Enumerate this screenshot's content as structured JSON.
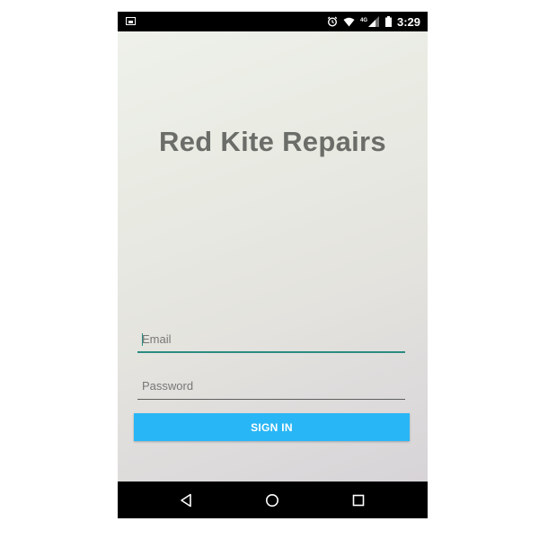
{
  "status_bar": {
    "time": "3:29",
    "icons": [
      "image-notification-icon",
      "alarm-icon",
      "wifi-icon",
      "signal-icon",
      "battery-icon"
    ]
  },
  "app": {
    "title": "Red Kite Repairs",
    "accent_color": "#29b6f6",
    "focus_color": "#2b8c82"
  },
  "login_form": {
    "email_placeholder": "Email",
    "email_value": "",
    "password_placeholder": "Password",
    "password_value": "",
    "sign_in_label": "SIGN IN"
  },
  "nav_bar": {
    "buttons": [
      "back-icon",
      "home-icon",
      "recents-icon"
    ]
  }
}
